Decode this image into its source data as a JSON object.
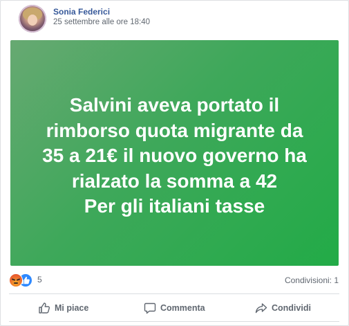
{
  "post": {
    "author": "Sonia Federici",
    "timestamp": "25 settembre alle ore 18:40",
    "image_text_lines": [
      "Salvini aveva portato il",
      "rimborso quota migrante da",
      "35 a 21€ il nuovo governo ha",
      "rialzato la somma a 42",
      "Per gli italiani tasse"
    ],
    "reactions": {
      "icons": [
        "angry-reaction-icon",
        "like-reaction-icon"
      ],
      "count": "5"
    },
    "shares_label": "Condivisioni: 1"
  },
  "actions": {
    "like_label": "Mi piace",
    "comment_label": "Commenta",
    "share_label": "Condividi"
  },
  "colors": {
    "author": "#365899",
    "meta": "#606770",
    "image_bg": "#3ea85a",
    "like_blue": "#2e89ff"
  }
}
